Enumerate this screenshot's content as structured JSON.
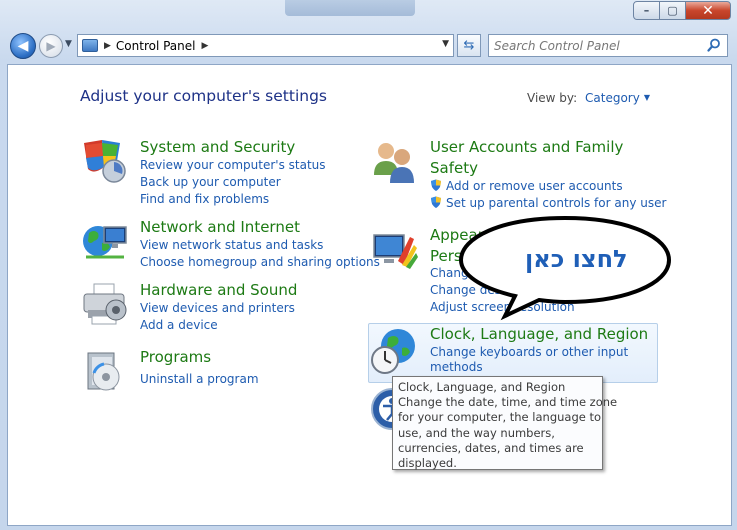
{
  "window": {
    "controls": {
      "minimize": "–",
      "maximize": "▢",
      "close": "✕"
    }
  },
  "nav": {
    "back_label": "◀",
    "forward_label": "▶",
    "breadcrumb": "Control Panel",
    "search_placeholder": "Search Control Panel"
  },
  "main": {
    "heading": "Adjust your computer's settings",
    "view_by_label": "View by:",
    "view_by_value": "Category"
  },
  "categories": [
    {
      "title": "System and Security",
      "links": [
        "Review your computer's status",
        "Back up your computer",
        "Find and fix problems"
      ]
    },
    {
      "title": "Network and Internet",
      "links": [
        "View network status and tasks",
        "Choose homegroup and sharing options"
      ]
    },
    {
      "title": "Hardware and Sound",
      "links": [
        "View devices and printers",
        "Add a device"
      ]
    },
    {
      "title": "Programs",
      "links": [
        "Uninstall a program"
      ]
    },
    {
      "title_lines": [
        "User Accounts and Family",
        "Safety"
      ],
      "links": [
        "Add or remove user accounts",
        "Set up parental controls for any user"
      ]
    },
    {
      "title_lines": [
        "Appearance and",
        "Personalization"
      ],
      "links": [
        "Change the theme",
        "Change desktop background",
        "Adjust screen resolution"
      ]
    },
    {
      "title": "Clock, Language, and Region",
      "links_lines": [
        "Change keyboards or other input",
        "methods"
      ]
    }
  ],
  "tooltip": {
    "lines": [
      "Clock, Language, and Region",
      "Change the date, time, and time zone",
      "for your computer, the language to",
      "use, and the way numbers,",
      "currencies, dates, and times are",
      "displayed."
    ]
  },
  "annotation": {
    "text": "לחצו כאן"
  },
  "colors": {
    "title_green": "#1d7a14",
    "link_blue": "#1e5bb0",
    "heading_navy": "#1e3287",
    "callout_blue": "#1f5fb7"
  }
}
